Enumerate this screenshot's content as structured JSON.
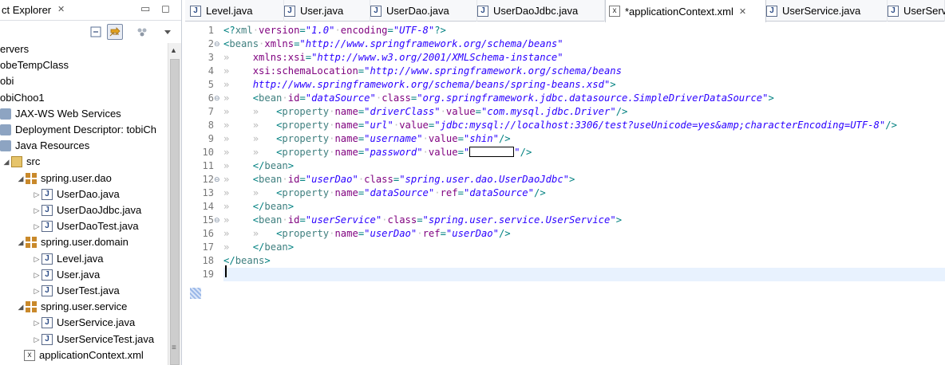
{
  "explorer": {
    "title": "ct Explorer",
    "tree": [
      {
        "label": "ervers",
        "indent": 0,
        "icon": "none",
        "twisty": ""
      },
      {
        "label": "obeTempClass",
        "indent": 0,
        "icon": "none",
        "twisty": ""
      },
      {
        "label": "obi",
        "indent": 0,
        "icon": "none",
        "twisty": ""
      },
      {
        "label": "obiChoo1",
        "indent": 0,
        "icon": "none",
        "twisty": ""
      },
      {
        "label": "JAX-WS Web Services",
        "indent": 0,
        "icon": "misc",
        "twisty": ""
      },
      {
        "label": "Deployment Descriptor: tobiCh",
        "indent": 0,
        "icon": "misc",
        "twisty": ""
      },
      {
        "label": "Java Resources",
        "indent": 0,
        "icon": "misc",
        "twisty": ""
      },
      {
        "label": "src",
        "indent": 1,
        "icon": "src",
        "twisty": "◢"
      },
      {
        "label": "spring.user.dao",
        "indent": 2,
        "icon": "pkg",
        "twisty": "◢"
      },
      {
        "label": "UserDao.java",
        "indent": 3,
        "icon": "java",
        "twisty": "▷"
      },
      {
        "label": "UserDaoJdbc.java",
        "indent": 3,
        "icon": "java",
        "twisty": "▷"
      },
      {
        "label": "UserDaoTest.java",
        "indent": 3,
        "icon": "java",
        "twisty": "▷"
      },
      {
        "label": "spring.user.domain",
        "indent": 2,
        "icon": "pkg",
        "twisty": "◢"
      },
      {
        "label": "Level.java",
        "indent": 3,
        "icon": "java",
        "twisty": "▷"
      },
      {
        "label": "User.java",
        "indent": 3,
        "icon": "java",
        "twisty": "▷"
      },
      {
        "label": "UserTest.java",
        "indent": 3,
        "icon": "java",
        "twisty": "▷"
      },
      {
        "label": "spring.user.service",
        "indent": 2,
        "icon": "pkg",
        "twisty": "◢"
      },
      {
        "label": "UserService.java",
        "indent": 3,
        "icon": "java",
        "twisty": "▷"
      },
      {
        "label": "UserServiceTest.java",
        "indent": 3,
        "icon": "java",
        "twisty": "▷"
      },
      {
        "label": "applicationContext.xml",
        "indent": 2,
        "icon": "xml",
        "twisty": ""
      }
    ]
  },
  "editor": {
    "tabs": [
      {
        "label": "Level.java",
        "icon": "java",
        "active": false
      },
      {
        "label": "User.java",
        "icon": "java",
        "active": false
      },
      {
        "label": "UserDao.java",
        "icon": "java",
        "active": false
      },
      {
        "label": "UserDaoJdbc.java",
        "icon": "java",
        "active": false
      },
      {
        "label": "*applicationContext.xml",
        "icon": "xml",
        "active": true
      },
      {
        "label": "UserService.java",
        "icon": "java",
        "active": false
      },
      {
        "label": "UserServ",
        "icon": "java",
        "active": false
      }
    ],
    "lines": [
      {
        "n": "1",
        "fold": "",
        "tokens": [
          [
            "p",
            "<?"
          ],
          [
            "t",
            "xml"
          ],
          [
            "s",
            "·"
          ],
          [
            "a",
            "version"
          ],
          [
            "p",
            "="
          ],
          [
            "v",
            "\"1.0\""
          ],
          [
            "s",
            "·"
          ],
          [
            "a",
            "encoding"
          ],
          [
            "p",
            "="
          ],
          [
            "v",
            "\"UTF-8\""
          ],
          [
            "p",
            "?>"
          ]
        ]
      },
      {
        "n": "2",
        "fold": "⊖",
        "tokens": [
          [
            "p",
            "<"
          ],
          [
            "t",
            "beans"
          ],
          [
            "s",
            "·"
          ],
          [
            "a",
            "xmlns"
          ],
          [
            "p",
            "="
          ],
          [
            "v",
            "\"http://www.springframework.org/schema/beans\""
          ]
        ]
      },
      {
        "n": "3",
        "fold": "",
        "tokens": [
          [
            "x",
            "» "
          ],
          [
            "s",
            "   "
          ],
          [
            "a",
            "xmlns:xsi"
          ],
          [
            "p",
            "="
          ],
          [
            "v",
            "\"http://www.w3.org/2001/XMLSchema-instance\""
          ]
        ]
      },
      {
        "n": "4",
        "fold": "",
        "tokens": [
          [
            "x",
            "» "
          ],
          [
            "s",
            "   "
          ],
          [
            "a",
            "xsi:schemaLocation"
          ],
          [
            "p",
            "="
          ],
          [
            "v",
            "\"http://www.springframework.org/schema/beans"
          ]
        ]
      },
      {
        "n": "5",
        "fold": "",
        "tokens": [
          [
            "x",
            "» "
          ],
          [
            "s",
            "   "
          ],
          [
            "v",
            "http://www.springframework.org/schema/beans/spring-beans.xsd\""
          ],
          [
            "p",
            ">"
          ]
        ]
      },
      {
        "n": "6",
        "fold": "⊖",
        "tokens": [
          [
            "x",
            "» "
          ],
          [
            "s",
            "   "
          ],
          [
            "p",
            "<"
          ],
          [
            "t",
            "bean"
          ],
          [
            "s",
            "·"
          ],
          [
            "a",
            "id"
          ],
          [
            "p",
            "="
          ],
          [
            "v",
            "\"dataSource\""
          ],
          [
            "s",
            "·"
          ],
          [
            "a",
            "class"
          ],
          [
            "p",
            "="
          ],
          [
            "v",
            "\"org.springframework.jdbc.datasource.SimpleDriverDataSource\""
          ],
          [
            "p",
            ">"
          ]
        ]
      },
      {
        "n": "7",
        "fold": "",
        "tokens": [
          [
            "x",
            "» "
          ],
          [
            "s",
            "   "
          ],
          [
            "x",
            "» "
          ],
          [
            "s",
            "  "
          ],
          [
            "p",
            "<"
          ],
          [
            "t",
            "property"
          ],
          [
            "s",
            "·"
          ],
          [
            "a",
            "name"
          ],
          [
            "p",
            "="
          ],
          [
            "v",
            "\"driverClass\""
          ],
          [
            "s",
            "·"
          ],
          [
            "a",
            "value"
          ],
          [
            "p",
            "="
          ],
          [
            "v",
            "\"com.mysql.jdbc.Driver\""
          ],
          [
            "p",
            "/>"
          ]
        ]
      },
      {
        "n": "8",
        "fold": "",
        "tokens": [
          [
            "x",
            "» "
          ],
          [
            "s",
            "   "
          ],
          [
            "x",
            "» "
          ],
          [
            "s",
            "  "
          ],
          [
            "p",
            "<"
          ],
          [
            "t",
            "property"
          ],
          [
            "s",
            "·"
          ],
          [
            "a",
            "name"
          ],
          [
            "p",
            "="
          ],
          [
            "v",
            "\"url\""
          ],
          [
            "s",
            "·"
          ],
          [
            "a",
            "value"
          ],
          [
            "p",
            "="
          ],
          [
            "v",
            "\"jdbc:mysql://localhost:3306/test?useUnicode=yes&amp;characterEncoding=UTF-8\""
          ],
          [
            "p",
            "/>"
          ]
        ]
      },
      {
        "n": "9",
        "fold": "",
        "tokens": [
          [
            "x",
            "» "
          ],
          [
            "s",
            "   "
          ],
          [
            "x",
            "» "
          ],
          [
            "s",
            "  "
          ],
          [
            "p",
            "<"
          ],
          [
            "t",
            "property"
          ],
          [
            "s",
            "·"
          ],
          [
            "a",
            "name"
          ],
          [
            "p",
            "="
          ],
          [
            "v",
            "\"username\""
          ],
          [
            "s",
            "·"
          ],
          [
            "a",
            "value"
          ],
          [
            "p",
            "="
          ],
          [
            "v",
            "\"shin\""
          ],
          [
            "p",
            "/>"
          ]
        ]
      },
      {
        "n": "10",
        "fold": "",
        "tokens": [
          [
            "x",
            "» "
          ],
          [
            "s",
            "   "
          ],
          [
            "x",
            "» "
          ],
          [
            "s",
            "  "
          ],
          [
            "p",
            "<"
          ],
          [
            "t",
            "property"
          ],
          [
            "s",
            "·"
          ],
          [
            "a",
            "name"
          ],
          [
            "p",
            "="
          ],
          [
            "v",
            "\"password\""
          ],
          [
            "s",
            "·"
          ],
          [
            "a",
            "value"
          ],
          [
            "p",
            "="
          ],
          [
            "v",
            "\""
          ],
          [
            "r",
            ""
          ],
          [
            "v",
            "\""
          ],
          [
            "p",
            "/>"
          ]
        ]
      },
      {
        "n": "11",
        "fold": "",
        "tokens": [
          [
            "x",
            "» "
          ],
          [
            "s",
            "   "
          ],
          [
            "p",
            "</"
          ],
          [
            "t",
            "bean"
          ],
          [
            "p",
            ">"
          ]
        ]
      },
      {
        "n": "12",
        "fold": "⊖",
        "tokens": [
          [
            "x",
            "» "
          ],
          [
            "s",
            "   "
          ],
          [
            "p",
            "<"
          ],
          [
            "t",
            "bean"
          ],
          [
            "s",
            "·"
          ],
          [
            "a",
            "id"
          ],
          [
            "p",
            "="
          ],
          [
            "v",
            "\"userDao\""
          ],
          [
            "s",
            "·"
          ],
          [
            "a",
            "class"
          ],
          [
            "p",
            "="
          ],
          [
            "v",
            "\"spring.user.dao.UserDaoJdbc\""
          ],
          [
            "p",
            ">"
          ]
        ]
      },
      {
        "n": "13",
        "fold": "",
        "tokens": [
          [
            "x",
            "» "
          ],
          [
            "s",
            "   "
          ],
          [
            "x",
            "» "
          ],
          [
            "s",
            "  "
          ],
          [
            "p",
            "<"
          ],
          [
            "t",
            "property"
          ],
          [
            "s",
            "·"
          ],
          [
            "a",
            "name"
          ],
          [
            "p",
            "="
          ],
          [
            "v",
            "\"dataSource\""
          ],
          [
            "s",
            "·"
          ],
          [
            "a",
            "ref"
          ],
          [
            "p",
            "="
          ],
          [
            "v",
            "\"dataSource\""
          ],
          [
            "p",
            "/>"
          ]
        ]
      },
      {
        "n": "14",
        "fold": "",
        "tokens": [
          [
            "x",
            "» "
          ],
          [
            "s",
            "   "
          ],
          [
            "p",
            "</"
          ],
          [
            "t",
            "bean"
          ],
          [
            "p",
            ">"
          ]
        ]
      },
      {
        "n": "15",
        "fold": "⊖",
        "tokens": [
          [
            "x",
            "» "
          ],
          [
            "s",
            "   "
          ],
          [
            "p",
            "<"
          ],
          [
            "t",
            "bean"
          ],
          [
            "s",
            "·"
          ],
          [
            "a",
            "id"
          ],
          [
            "p",
            "="
          ],
          [
            "v",
            "\"userService\""
          ],
          [
            "s",
            "·"
          ],
          [
            "a",
            "class"
          ],
          [
            "p",
            "="
          ],
          [
            "v",
            "\"spring.user.service.UserService\""
          ],
          [
            "p",
            ">"
          ]
        ]
      },
      {
        "n": "16",
        "fold": "",
        "tokens": [
          [
            "x",
            "» "
          ],
          [
            "s",
            "   "
          ],
          [
            "x",
            "» "
          ],
          [
            "s",
            "  "
          ],
          [
            "p",
            "<"
          ],
          [
            "t",
            "property"
          ],
          [
            "s",
            "·"
          ],
          [
            "a",
            "name"
          ],
          [
            "p",
            "="
          ],
          [
            "v",
            "\"userDao\""
          ],
          [
            "s",
            "·"
          ],
          [
            "a",
            "ref"
          ],
          [
            "p",
            "="
          ],
          [
            "v",
            "\"userDao\""
          ],
          [
            "p",
            "/>"
          ]
        ]
      },
      {
        "n": "17",
        "fold": "",
        "tokens": [
          [
            "x",
            "» "
          ],
          [
            "s",
            "   "
          ],
          [
            "p",
            "</"
          ],
          [
            "t",
            "bean"
          ],
          [
            "p",
            ">"
          ]
        ]
      },
      {
        "n": "18",
        "fold": "",
        "tokens": [
          [
            "p",
            "</"
          ],
          [
            "t",
            "beans"
          ],
          [
            "p",
            ">"
          ]
        ]
      },
      {
        "n": "19",
        "fold": "",
        "tokens": []
      }
    ],
    "current_line": "19"
  },
  "icons": {
    "close": "close-icon",
    "minimize": "minimize-icon",
    "maximize": "maximize-icon",
    "collapse_all": "collapse-all-icon",
    "link_editor": "link-with-editor-icon",
    "view_menu": "view-menu-icon"
  },
  "colors": {
    "tag": "#3f7f7f",
    "attr": "#7f007f",
    "value": "#2a00ff",
    "line_number": "#787878"
  }
}
